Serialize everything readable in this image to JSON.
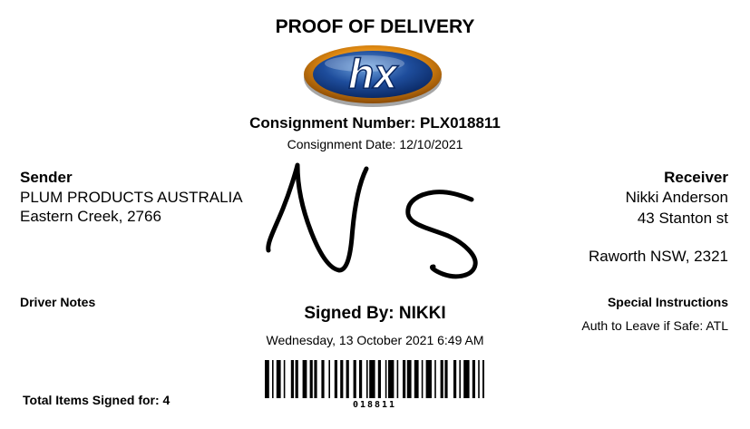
{
  "title": "PROOF OF DELIVERY",
  "logo": {
    "text": "hx",
    "colors": {
      "ring": "#e08a12",
      "oval": "#1e4d9c",
      "highlight": "#6fa4e0"
    }
  },
  "consignment": {
    "number_label": "Consignment Number: PLX018811",
    "date_label": "Consignment Date: 12/10/2021"
  },
  "sender": {
    "heading": "Sender",
    "line1": "PLUM PRODUCTS AUSTRALIA",
    "line2": "Eastern Creek, 2766"
  },
  "receiver": {
    "heading": "Receiver",
    "line1": "Nikki Anderson",
    "line2": "43 Stanton st",
    "line3": "Raworth NSW, 2321"
  },
  "driver_notes": {
    "heading": "Driver Notes"
  },
  "signature": {
    "image": "handwritten-signature"
  },
  "signed": {
    "by_label": "Signed By: NIKKI",
    "datetime": "Wednesday, 13 October 2021 6:49 AM"
  },
  "special_instructions": {
    "heading": "Special Instructions",
    "value": "Auth to Leave if Safe: ATL"
  },
  "barcode": {
    "number": "018811"
  },
  "total_items": "Total Items Signed for: 4"
}
